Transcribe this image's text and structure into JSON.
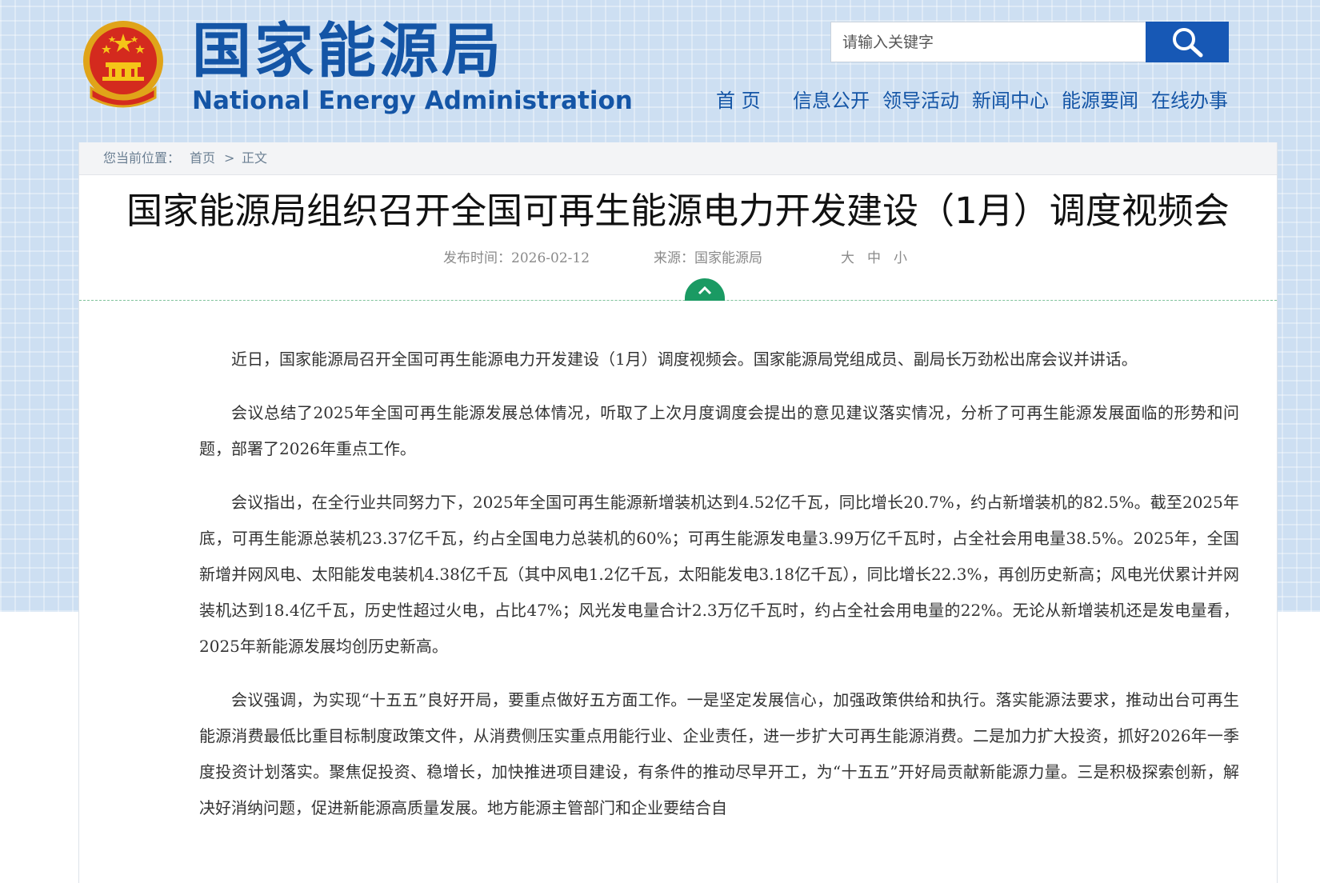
{
  "header": {
    "site_title_cn": "国家能源局",
    "site_title_en": "National Energy Administration",
    "brand_color": "#1455a6",
    "emblem_icon": "national-emblem-icon"
  },
  "search": {
    "placeholder": "请输入关键字",
    "button_icon": "search-icon"
  },
  "nav": {
    "items": [
      {
        "label": "首 页"
      },
      {
        "label": "信息公开"
      },
      {
        "label": "领导活动"
      },
      {
        "label": "新闻中心"
      },
      {
        "label": "能源要闻"
      },
      {
        "label": "在线办事"
      }
    ]
  },
  "breadcrumb": {
    "prefix": "您当前位置：",
    "home": "首页",
    "separator": ">",
    "current": "正文"
  },
  "article": {
    "title": "国家能源局组织召开全国可再生能源电力开发建设（1月）调度视频会",
    "publish_label": "发布时间：2026-02-12",
    "source_label": "来源：国家能源局",
    "font_sizes": [
      "大",
      "中",
      "小"
    ],
    "toggle_icon": "chevron-up-icon",
    "accent_color": "#1a9a63",
    "paragraphs": [
      "近日，国家能源局召开全国可再生能源电力开发建设（1月）调度视频会。国家能源局党组成员、副局长万劲松出席会议并讲话。",
      "会议总结了2025年全国可再生能源发展总体情况，听取了上次月度调度会提出的意见建议落实情况，分析了可再生能源发展面临的形势和问题，部署了2026年重点工作。",
      "会议指出，在全行业共同努力下，2025年全国可再生能源新增装机达到4.52亿千瓦，同比增长20.7%，约占新增装机的82.5%。截至2025年底，可再生能源总装机23.37亿千瓦，约占全国电力总装机的60%；可再生能源发电量3.99万亿千瓦时，占全社会用电量38.5%。2025年，全国新增并网风电、太阳能发电装机4.38亿千瓦（其中风电1.2亿千瓦，太阳能发电3.18亿千瓦），同比增长22.3%，再创历史新高；风电光伏累计并网装机达到18.4亿千瓦，历史性超过火电，占比47%；风光发电量合计2.3万亿千瓦时，约占全社会用电量的22%。无论从新增装机还是发电量看，2025年新能源发展均创历史新高。",
      "会议强调，为实现“十五五”良好开局，要重点做好五方面工作。一是坚定发展信心，加强政策供给和执行。落实能源法要求，推动出台可再生能源消费最低比重目标制度政策文件，从消费侧压实重点用能行业、企业责任，进一步扩大可再生能源消费。二是加力扩大投资，抓好2026年一季度投资计划落实。聚焦促投资、稳增长，加快推进项目建设，有条件的推动尽早开工，为“十五五”开好局贡献新能源力量。三是积极探索创新，解决好消纳问题，促进新能源高质量发展。地方能源主管部门和企业要结合自"
    ]
  }
}
